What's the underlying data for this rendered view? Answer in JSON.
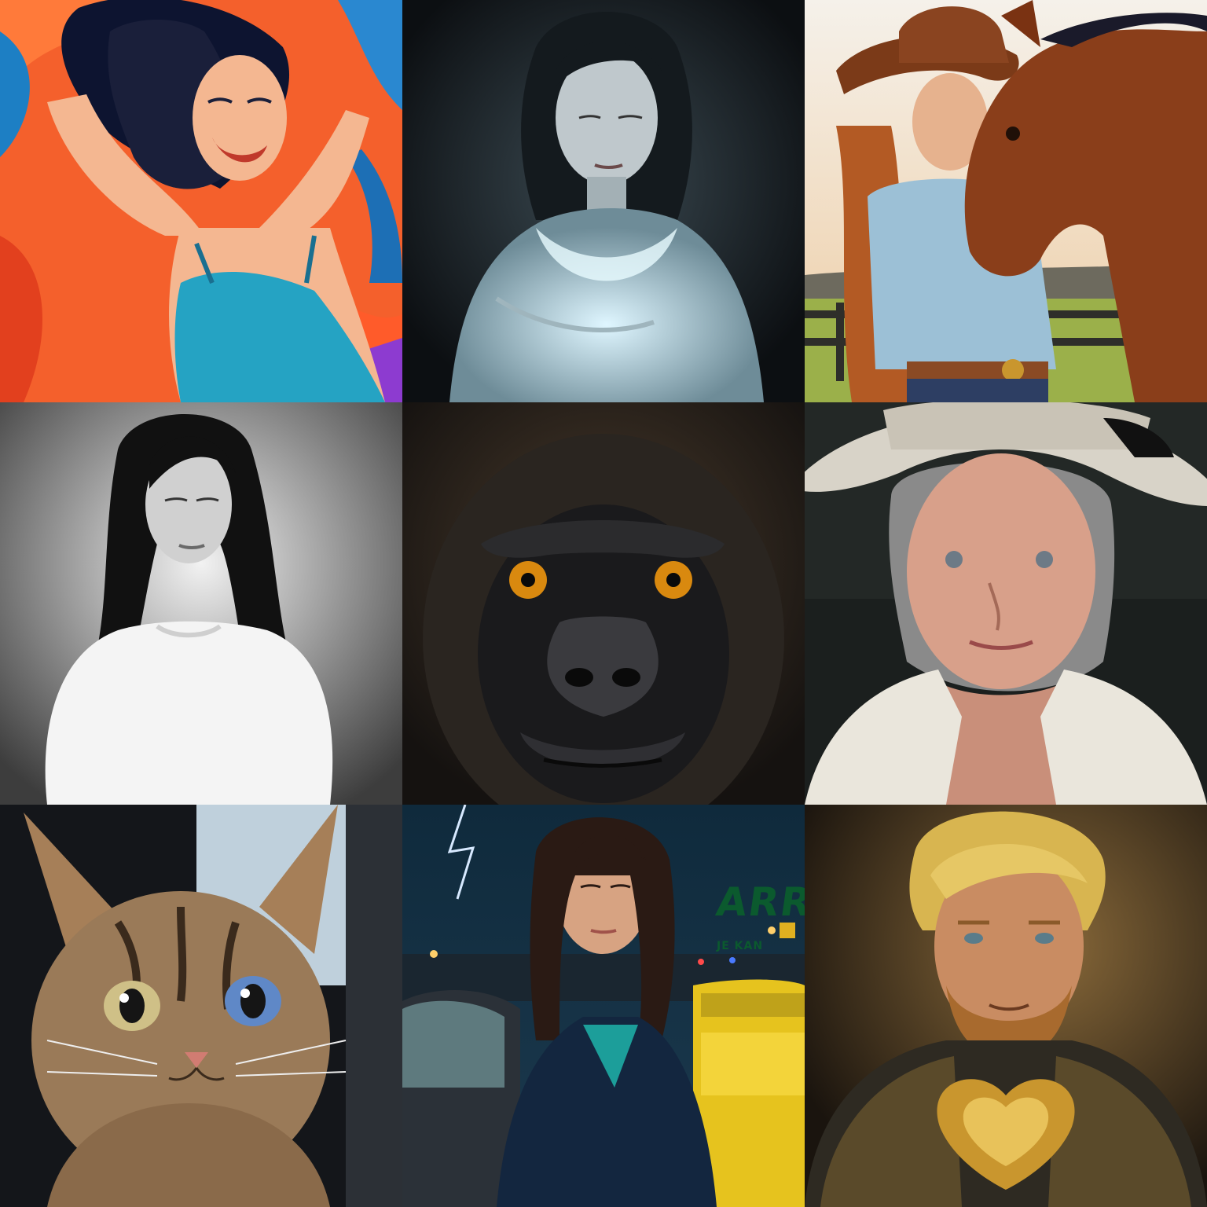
{
  "grid": {
    "rows": 3,
    "columns": 3,
    "tiles": [
      {
        "subject": "woman-dancing-illustration"
      },
      {
        "subject": "ghostly-girl-portrait"
      },
      {
        "subject": "cowgirl-with-horse"
      },
      {
        "subject": "monochrome-woman-portrait"
      },
      {
        "subject": "gorilla-closeup"
      },
      {
        "subject": "elderly-woman-in-hat"
      },
      {
        "subject": "tabby-kitten"
      },
      {
        "subject": "woman-in-city-night"
      },
      {
        "subject": "blond-man-portrait"
      }
    ]
  },
  "taxi_sign": {
    "main": "ARRO",
    "sub": "JE KAN"
  }
}
